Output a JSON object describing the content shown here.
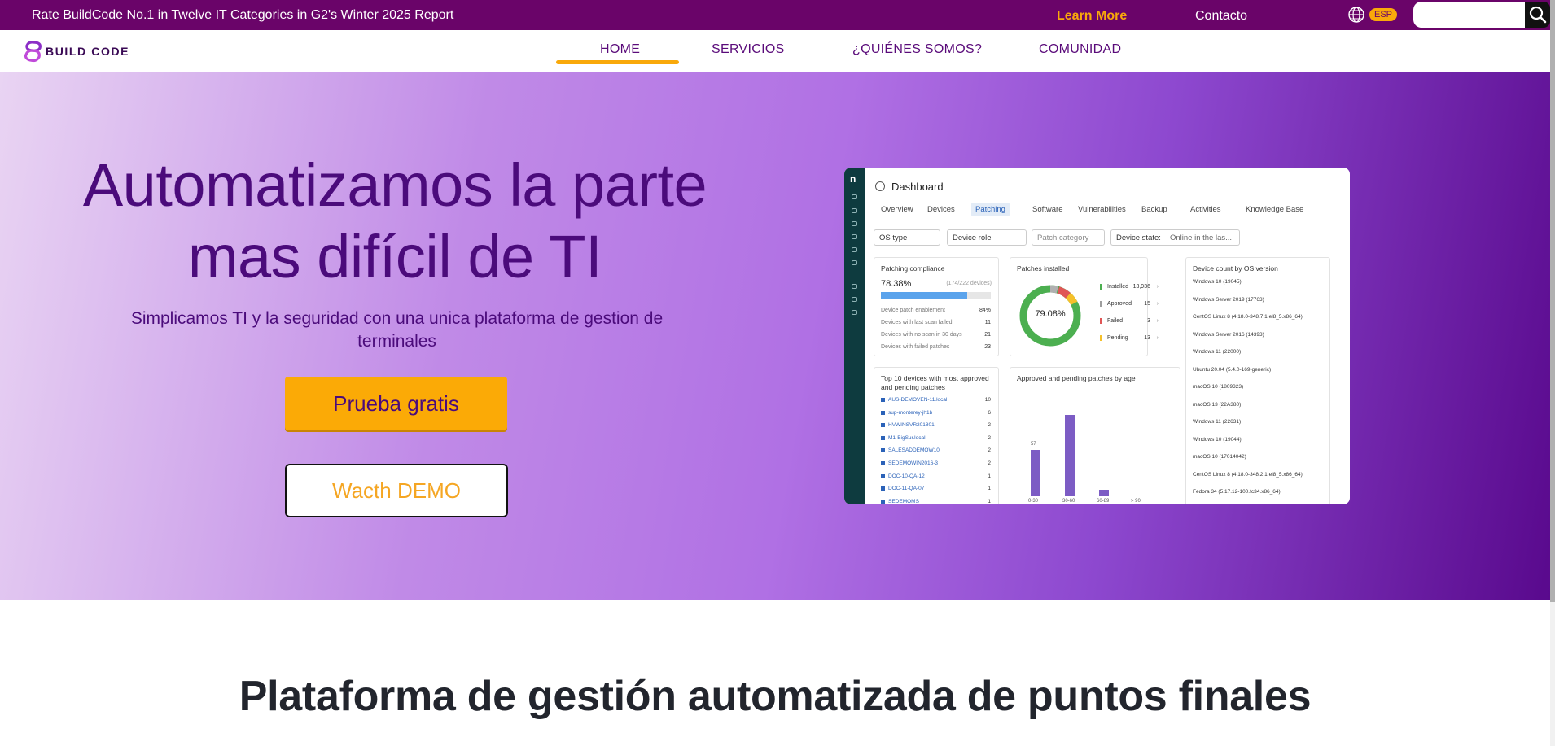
{
  "topbar": {
    "announcement": "Rate BuildCode No.1 in Twelve IT Categories in G2's Winter 2025 Report",
    "learn_more": "Learn More",
    "contact": "Contacto",
    "language": "ESP",
    "search_placeholder": ""
  },
  "nav": {
    "brand": "BUILD CODE",
    "items": [
      "HOME",
      "SERVICIOS",
      "¿QUIÉNES SOMOS?",
      "COMUNIDAD"
    ],
    "active": "HOME"
  },
  "hero": {
    "headline_line1": "Automatizamos la parte",
    "headline_line2": "mas difícil de TI",
    "subtitle": "Simplicamos TI y la seguridad con una unica plataforma de gestion de terminales",
    "primary_cta": "Prueba gratis",
    "secondary_cta": "Wacth DEMO"
  },
  "dashboard": {
    "logo": "n",
    "title": "Dashboard",
    "tabs": [
      "Overview",
      "Devices",
      "Patching",
      "Software",
      "Vulnerabilities",
      "Backup",
      "Activities",
      "Knowledge Base"
    ],
    "active_tab": "Patching",
    "filters": [
      "OS type",
      "Device role",
      "Patch category",
      "Device state:",
      "Online in the las..."
    ],
    "compliance": {
      "title": "Patching compliance",
      "percent": "78.38%",
      "devices": "(174/222 devices)",
      "fill_fraction": 0.7838,
      "rows": [
        {
          "label": "Device patch enablement",
          "value": "84%"
        },
        {
          "label": "Devices with last scan failed",
          "value": "11"
        },
        {
          "label": "Devices with no scan in 30 days",
          "value": "21"
        },
        {
          "label": "Devices with failed patches",
          "value": "23"
        }
      ]
    },
    "patches": {
      "title": "Patches installed",
      "percent": "79.08%",
      "rows": [
        {
          "label": "Installed",
          "value": "13,936",
          "color": "#4caf50"
        },
        {
          "label": "Approved",
          "value": "15",
          "color": "#9e9e9e"
        },
        {
          "label": "Failed",
          "value": "3",
          "color": "#e05656"
        },
        {
          "label": "Pending",
          "value": "13",
          "color": "#f5c02a"
        }
      ]
    },
    "os": {
      "title": "Device count by OS version",
      "rows": [
        "Windows 10 (19045)",
        "Windows Server 2019 (17763)",
        "CentOS Linux 8 (4.18.0-348.7.1.el8_5.x86_64)",
        "Windows Server 2016 (14393)",
        "Windows 11 (22000)",
        "Ubuntu 20.04 (5.4.0-169-generic)",
        "macOS 10 (1809323)",
        "macOS 13 (22A380)",
        "Windows 11 (22631)",
        "Windows 10 (19044)",
        "macOS 10 (17014042)",
        "CentOS Linux 8 (4.18.0-348.2.1.el8_5.x86_64)",
        "Fedora 34 (5.17.12-100.fc34.x86_64)"
      ]
    },
    "top_devices": {
      "title": "Top 10 devices with most approved and pending patches",
      "rows": [
        {
          "name": "AUS-DEMOVEN-11.local",
          "value": "10"
        },
        {
          "name": "sup-monterey-jh1b",
          "value": "6"
        },
        {
          "name": "HVWINSVR201801",
          "value": "2"
        },
        {
          "name": "M1-BigSur.local",
          "value": "2"
        },
        {
          "name": "SALESADDEMOW10",
          "value": "2"
        },
        {
          "name": "SEDEMOWIN2016-3",
          "value": "2"
        },
        {
          "name": "DOC-10-QA-12",
          "value": "1"
        },
        {
          "name": "DOC-11-QA-07",
          "value": "1"
        },
        {
          "name": "SEDEMOMS",
          "value": "1"
        }
      ]
    },
    "age": {
      "title": "Approved and pending patches by age",
      "categories": [
        "0-30",
        "30-60",
        "60-89",
        "> 90"
      ],
      "values": [
        57,
        100,
        8,
        0
      ],
      "label": "57"
    }
  },
  "section": {
    "title": "Plataforma de gestión automatizada de puntos finales"
  }
}
